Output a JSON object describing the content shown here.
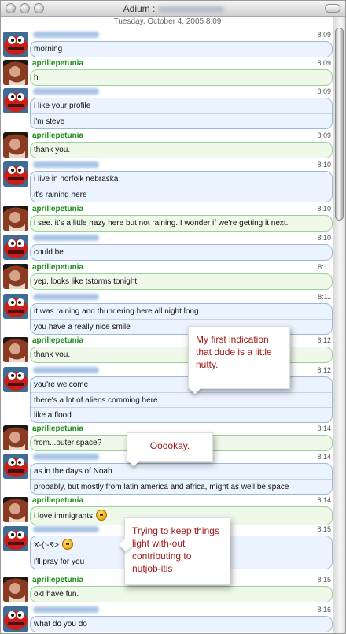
{
  "window": {
    "title": "Adium :"
  },
  "transcript": {
    "date": "Tuesday, October 4, 2005 8:09",
    "messages": [
      {
        "sender": "",
        "is_self": false,
        "time": "8:09",
        "lines": [
          "morning"
        ]
      },
      {
        "sender": "aprillepetunia",
        "is_self": true,
        "time": "8:09",
        "lines": [
          "hi"
        ]
      },
      {
        "sender": "",
        "is_self": false,
        "time": "8:09",
        "lines": [
          "i like your profile",
          "i'm steve"
        ]
      },
      {
        "sender": "aprillepetunia",
        "is_self": true,
        "time": "8:09",
        "lines": [
          "thank you."
        ]
      },
      {
        "sender": "",
        "is_self": false,
        "time": "8:10",
        "lines": [
          "i live in norfolk nebraska",
          "it's raining here"
        ]
      },
      {
        "sender": "aprillepetunia",
        "is_self": true,
        "time": "8:10",
        "lines": [
          "i see. it's a little hazy here but not raining. I wonder if we're getting it next."
        ]
      },
      {
        "sender": "",
        "is_self": false,
        "time": "8:10",
        "lines": [
          "could be"
        ]
      },
      {
        "sender": "aprillepetunia",
        "is_self": true,
        "time": "8:11",
        "lines": [
          "yep, looks like tstorms tonight."
        ]
      },
      {
        "sender": "",
        "is_self": false,
        "time": "8:11",
        "lines": [
          "it was raining and thundering here all night long",
          "you have a really nice smile"
        ]
      },
      {
        "sender": "aprillepetunia",
        "is_self": true,
        "time": "8:12",
        "lines": [
          "thank you."
        ]
      },
      {
        "sender": "",
        "is_self": false,
        "time": "8:12",
        "lines": [
          "you're welcome",
          "there's a lot of aliens comming here",
          "like a flood"
        ]
      },
      {
        "sender": "aprillepetunia",
        "is_self": true,
        "time": "8:14",
        "lines": [
          "from...outer space?"
        ]
      },
      {
        "sender": "",
        "is_self": false,
        "time": "8:14",
        "lines": [
          "as in the days of Noah",
          "probably, but mostly from latin america and africa, might as well be space"
        ]
      },
      {
        "sender": "aprillepetunia",
        "is_self": true,
        "time": "8:14",
        "lines": [
          "i love immigrants"
        ]
      },
      {
        "sender": "",
        "is_self": false,
        "time": "8:15",
        "lines": [
          "X-(:-&>",
          "i'll pray for you"
        ]
      },
      {
        "sender": "aprillepetunia",
        "is_self": true,
        "time": "8:15",
        "lines": [
          "ok! have fun."
        ]
      },
      {
        "sender": "",
        "is_self": false,
        "time": "8:16",
        "lines": [
          "what do you do"
        ]
      }
    ]
  },
  "annotations": [
    {
      "text": "My first indication that dude is a little nutty."
    },
    {
      "text": "Ooookay."
    },
    {
      "text": "Trying to keep things light with-out contributing to nutjob-itis"
    }
  ]
}
